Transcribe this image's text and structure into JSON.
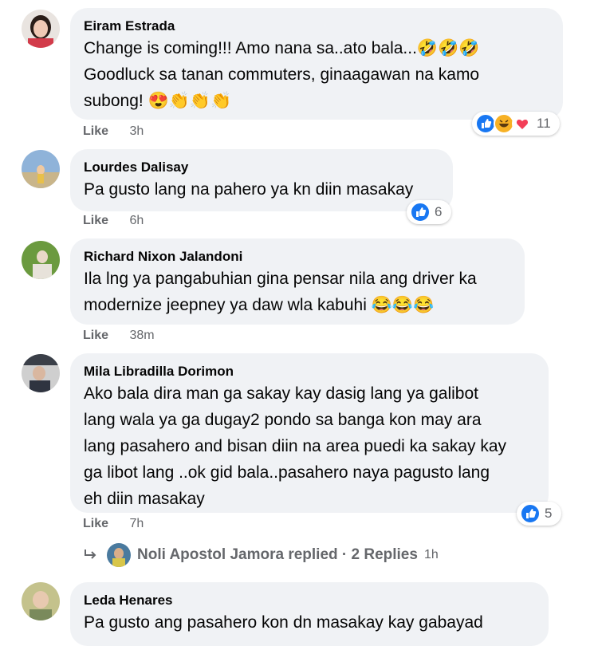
{
  "comments": [
    {
      "author": "Eiram Estrada",
      "text": "Change is coming!!! Amo nana sa..ato bala...🤣🤣🤣\nGoodluck sa tanan commuters, ginaagawan na kamo\nsubong! 😍👏👏👏",
      "like_label": "Like",
      "time": "3h",
      "reaction_count": "11"
    },
    {
      "author": "Lourdes Dalisay",
      "text": "Pa gusto lang na pahero ya kn diin masakay",
      "like_label": "Like",
      "time": "6h",
      "reaction_count": "6"
    },
    {
      "author": "Richard Nixon Jalandoni",
      "text": "Ila lng ya pangabuhian gina pensar nila ang driver ka\nmodernize jeepney ya daw wla kabuhi 😂😂😂",
      "like_label": "Like",
      "time": "38m",
      "reaction_count": ""
    },
    {
      "author": "Mila Libradilla Dorimon",
      "text": "Ako bala dira man ga sakay kay dasig lang ya galibot\nlang wala ya ga dugay2 pondo sa banga kon may ara\nlang pasahero and bisan diin na area puedi ka sakay kay\nga libot lang ..ok gid bala..pasahero naya pagusto lang\neh diin masakay",
      "like_label": "Like",
      "time": "7h",
      "reaction_count": "5"
    },
    {
      "author": "Leda Henares",
      "text": "Pa gusto ang pasahero kon dn masakay kay gabayad",
      "like_label": "",
      "time": "",
      "reaction_count": ""
    }
  ],
  "reply": {
    "name": "Noli Apostol Jamora replied · 2 Replies",
    "time": "1h"
  },
  "colors": {
    "bubble": "#f0f2f5",
    "meta": "#65676b",
    "like_blue": "#1877f2",
    "haha_yellow": "#f7b125",
    "love_red": "#f33e58"
  },
  "icons": [
    "like-reaction-icon",
    "haha-reaction-icon",
    "love-reaction-icon",
    "reply-arrow-icon"
  ]
}
